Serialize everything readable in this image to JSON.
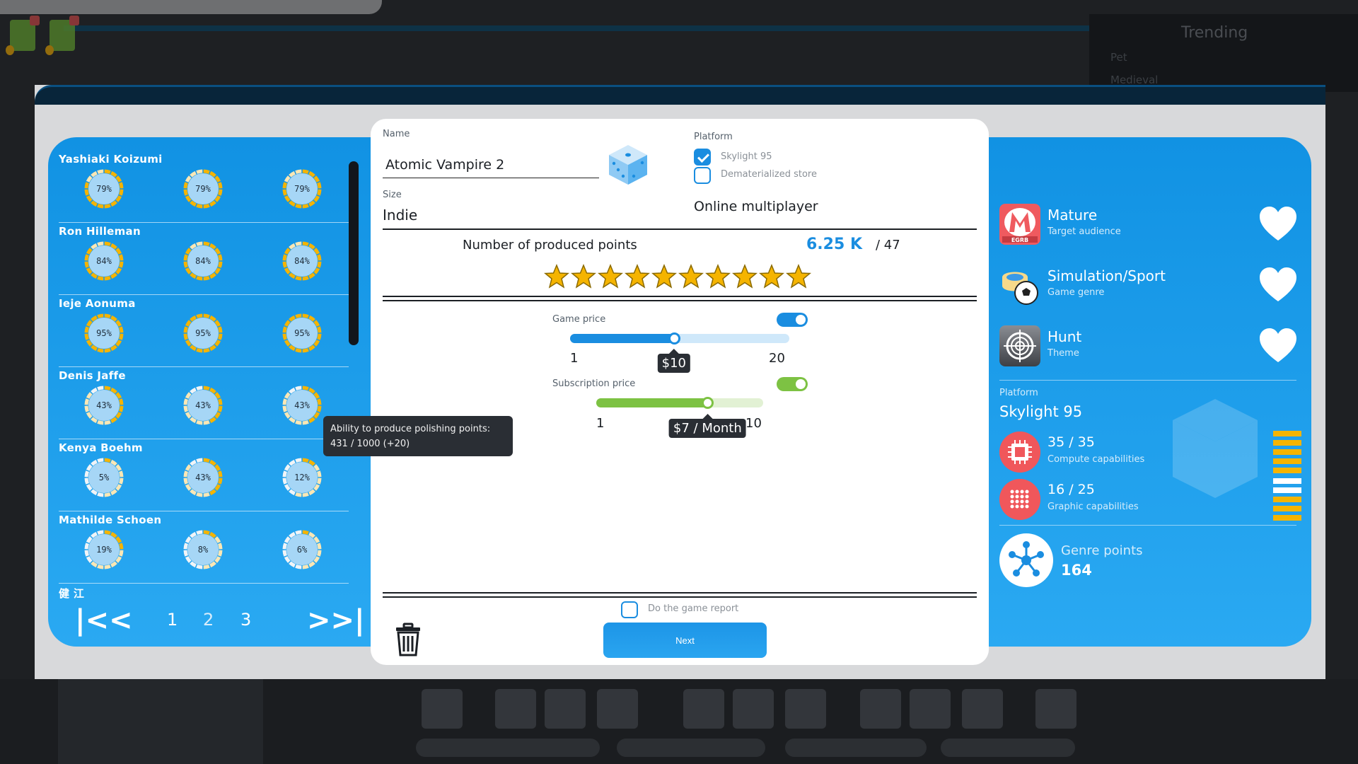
{
  "background": {
    "trending": {
      "title": "Trending",
      "items": [
        "Pet",
        "Medieval"
      ]
    }
  },
  "developers": [
    {
      "name": "Yashiaki Koizumi",
      "skills": [
        79,
        79,
        79
      ]
    },
    {
      "name": "Ron Hilleman",
      "skills": [
        84,
        84,
        84
      ]
    },
    {
      "name": "Ieje Aonuma",
      "skills": [
        95,
        95,
        95
      ]
    },
    {
      "name": "Denis Jaffe",
      "skills": [
        43,
        43,
        43
      ]
    },
    {
      "name": "Kenya Boehm",
      "skills": [
        5,
        43,
        12
      ]
    },
    {
      "name": "Mathilde Schoen",
      "skills": [
        19,
        8,
        6
      ]
    },
    {
      "name": "健 江",
      "skills": []
    }
  ],
  "developer_labels": [
    [
      "79%",
      "79%",
      "79%"
    ],
    [
      "84%",
      "84%",
      "84%"
    ],
    [
      "95%",
      "95%",
      "95%"
    ],
    [
      "43%",
      "43%",
      "43%"
    ],
    [
      "5%",
      "43%",
      "12%"
    ],
    [
      "19%",
      "8%",
      "6%"
    ]
  ],
  "pager": {
    "first": "|<<",
    "last": ">>|",
    "pages": [
      "1",
      "2",
      "3"
    ],
    "current": "2"
  },
  "tooltip": {
    "line1": "Ability to produce polishing points:",
    "line2": "431 / 1000 (+20)"
  },
  "game": {
    "name_label": "Name",
    "name_value": "Atomic Vampire 2",
    "size_label": "Size",
    "size_value": "Indie",
    "platform_label": "Platform",
    "platforms": [
      {
        "label": "Skylight 95",
        "checked": true
      },
      {
        "label": "Dematerialized store",
        "checked": false
      }
    ],
    "online": "Online multiplayer",
    "points_label": "Number of produced points",
    "points_value": "6.25 K",
    "points_max": "/ 47",
    "stars": 10
  },
  "pricing": {
    "game_price": {
      "label": "Game price",
      "min": "1",
      "max": "20",
      "value": 10,
      "value_label": "$10",
      "enabled": true
    },
    "subscription": {
      "label": "Subscription price",
      "min": "1",
      "max": "10",
      "value": 7,
      "value_label": "$7  / Month",
      "enabled": true
    }
  },
  "footer": {
    "report_label": "Do the game report",
    "report_checked": false,
    "next_label": "Next"
  },
  "attributes": [
    {
      "title": "Mature",
      "sub": "Target audience",
      "icon": "egrb-rating-icon"
    },
    {
      "title": "Simulation/Sport",
      "sub": "Game genre",
      "icon": "genre-sport-icon"
    },
    {
      "title": "Hunt",
      "sub": "Theme",
      "icon": "crosshair-icon"
    }
  ],
  "platform_info": {
    "label": "Platform",
    "name": "Skylight 95",
    "compute": {
      "value": "35 / 35",
      "label": "Compute capabilities",
      "filled": 5,
      "total": 5
    },
    "graphic": {
      "value": "16 / 25",
      "label": "Graphic capabilities",
      "filled": 3,
      "total": 5
    }
  },
  "genre_points": {
    "label": "Genre points",
    "value": "164"
  },
  "colors": {
    "accent": "#1a8de0",
    "gold": "#f5b400",
    "green": "#7dc243",
    "red": "#f0575b"
  }
}
